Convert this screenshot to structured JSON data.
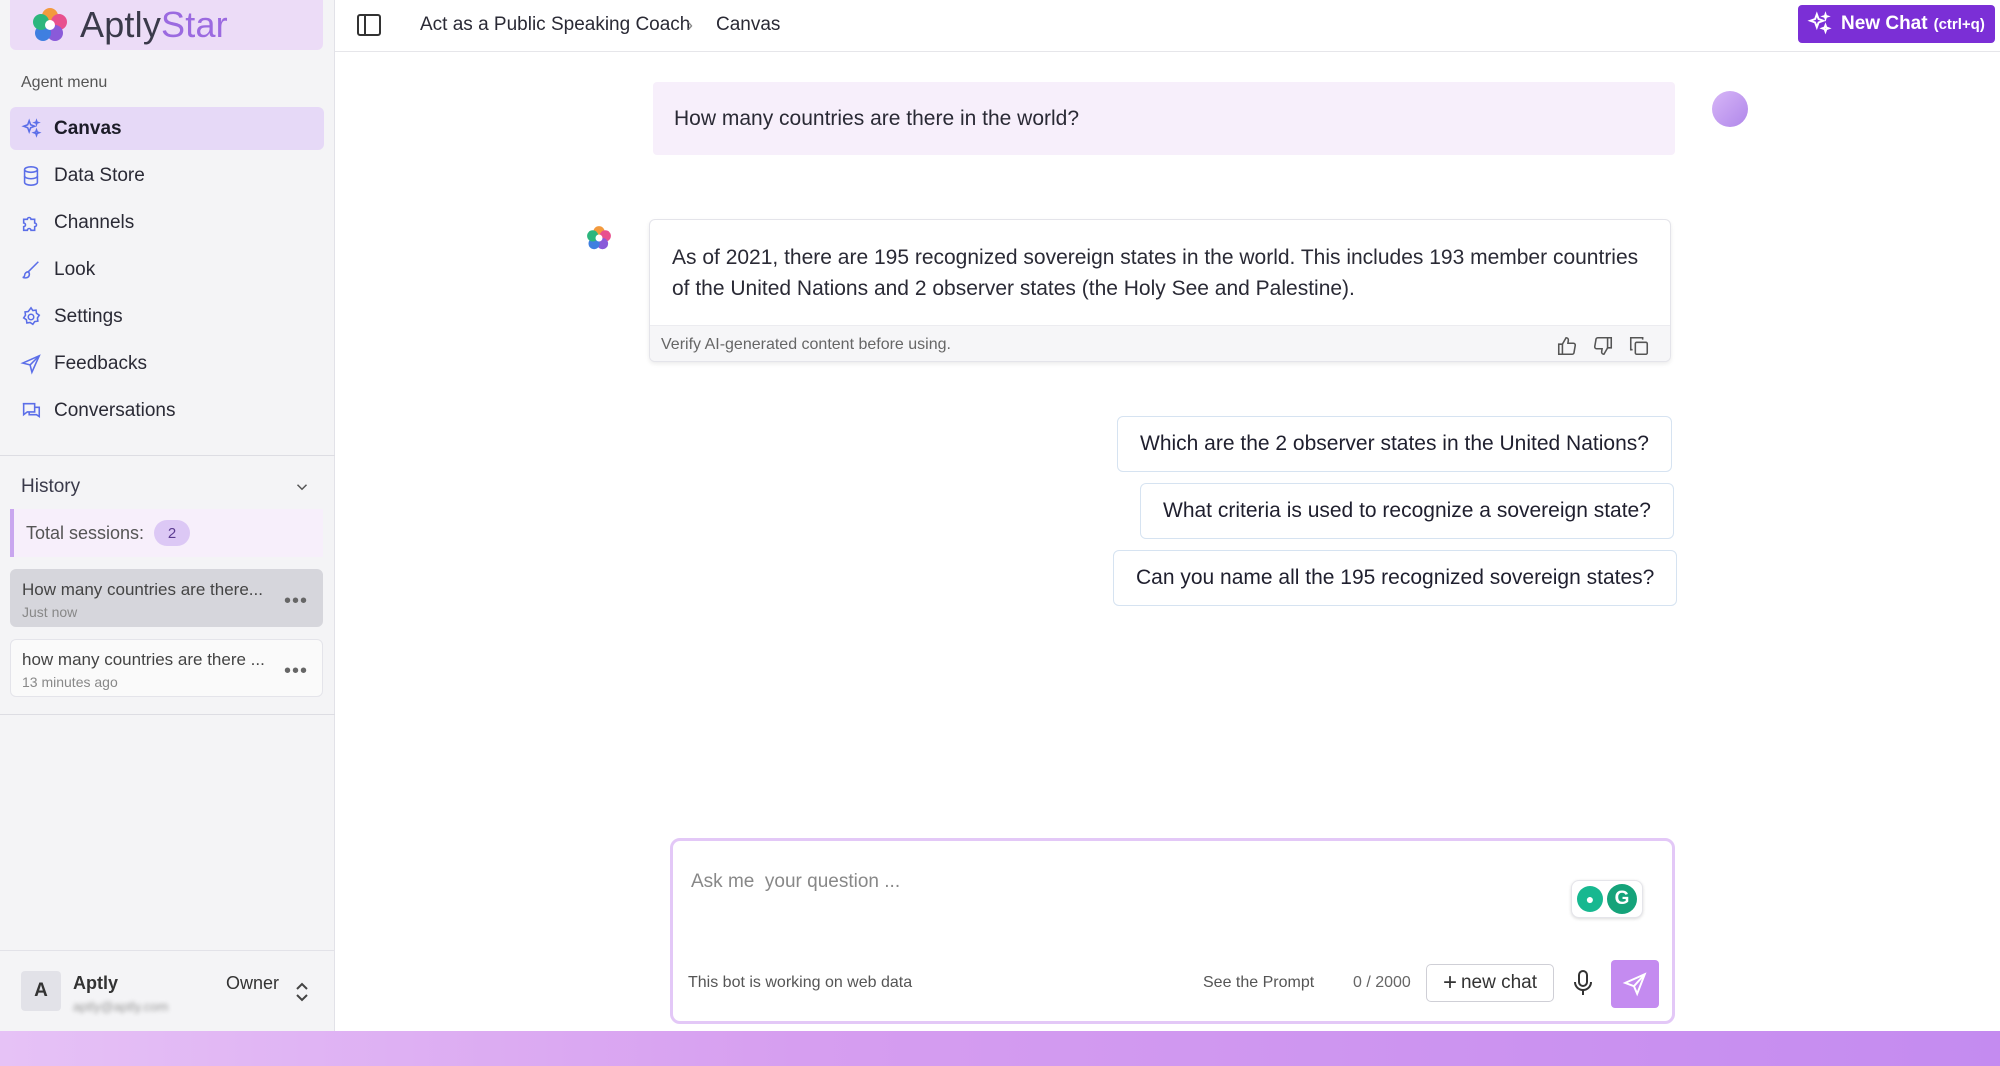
{
  "brand": {
    "name_part1": "Aptly",
    "name_part2": "Star"
  },
  "sidebar": {
    "section_label": "Agent menu",
    "items": [
      {
        "label": "Canvas",
        "icon": "sparkle-icon",
        "active": true
      },
      {
        "label": "Data Store",
        "icon": "database-icon"
      },
      {
        "label": "Channels",
        "icon": "puzzle-icon"
      },
      {
        "label": "Look",
        "icon": "brush-icon"
      },
      {
        "label": "Settings",
        "icon": "gear-icon"
      },
      {
        "label": "Feedbacks",
        "icon": "send-icon"
      },
      {
        "label": "Conversations",
        "icon": "chat-icon"
      }
    ],
    "history": {
      "label": "History",
      "sessions_label": "Total sessions:",
      "sessions_count": "2",
      "items": [
        {
          "title": "How many countries are there...",
          "time": "Just now"
        },
        {
          "title": "how many countries are there ...",
          "time": "13 minutes ago"
        }
      ]
    },
    "user": {
      "initial": "A",
      "name": "Aptly",
      "email": "aptly@aptly.com",
      "role": "Owner"
    }
  },
  "topbar": {
    "breadcrumb": [
      "Act as a Public Speaking Coach",
      "Canvas"
    ],
    "new_chat_label": "New Chat",
    "new_chat_shortcut": "(ctrl+q)"
  },
  "chat": {
    "user_message": "How many countries are there in the world?",
    "bot_message": "As of 2021, there are 195 recognized sovereign states in the world. This includes 193 member countries of the United Nations and 2 observer states (the Holy See and Palestine).",
    "bot_footer": "Verify AI-generated content before using.",
    "suggestions": [
      "Which are the 2 observer states in the United Nations?",
      "What criteria is used to recognize a sovereign state?",
      "Can you name all the 195 recognized sovereign states?"
    ]
  },
  "composer": {
    "placeholder": "Ask me  your question ...",
    "web_note": "This bot is working on web data",
    "see_prompt": "See the Prompt",
    "counter": "0 / 2000",
    "new_chat_label": "new chat"
  },
  "colors": {
    "accent": "#7b2fd6",
    "accent_light": "#e6d9f7",
    "send": "#c48bf0"
  }
}
